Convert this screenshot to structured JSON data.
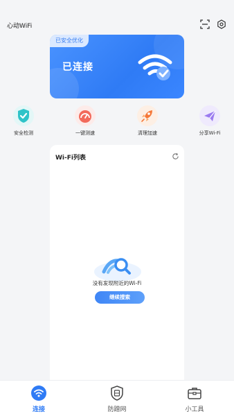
{
  "app": {
    "title": "心动WiFi"
  },
  "header": {
    "icons": [
      "scan-icon",
      "settings-icon"
    ]
  },
  "connection_card": {
    "badge": "已安全优化",
    "status": "已连接",
    "icon": "wifi-check-icon"
  },
  "quick_actions": [
    {
      "label": "安全检测",
      "icon": "shield-check-icon"
    },
    {
      "label": "一键测速",
      "icon": "speedometer-icon"
    },
    {
      "label": "清理加速",
      "icon": "rocket-icon"
    },
    {
      "label": "分享Wi-Fi",
      "icon": "paper-plane-icon"
    }
  ],
  "wifi_list": {
    "title": "Wi-Fi列表",
    "empty_text": "没有发现附近的Wi-Fi",
    "rescan_label": "继续搜索"
  },
  "bottom_nav": [
    {
      "label": "连接",
      "icon": "wifi-icon",
      "active": true
    },
    {
      "label": "防蹭网",
      "icon": "shield-net-icon",
      "active": false
    },
    {
      "label": "小工具",
      "icon": "toolbox-icon",
      "active": false
    }
  ],
  "colors": {
    "accent": "#2f7bf5",
    "background": "#f4f5f7"
  }
}
